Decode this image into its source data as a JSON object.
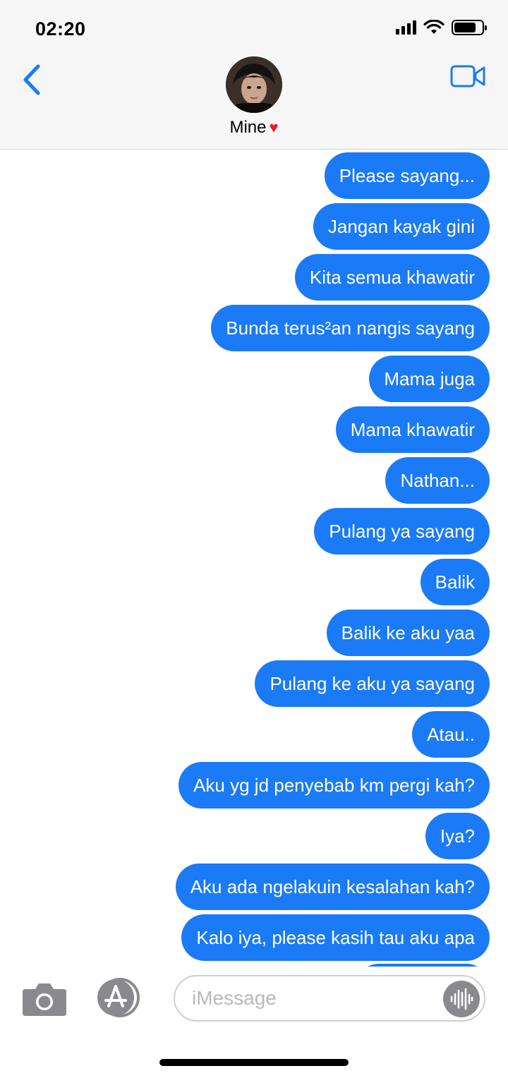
{
  "status_bar": {
    "time": "02:20"
  },
  "header": {
    "contact_name": "Mine",
    "contact_emoji": "♥",
    "back_icon": "chevron-left-icon",
    "video_icon": "video-camera-icon",
    "accent_color": "#1b7af6"
  },
  "messages": [
    {
      "text": "Please sayang..."
    },
    {
      "text": "Jangan kayak gini"
    },
    {
      "text": "Kita semua khawatir"
    },
    {
      "text": "Bunda terus²an nangis sayang"
    },
    {
      "text": "Mama juga"
    },
    {
      "text": "Mama khawatir"
    },
    {
      "text": "Nathan..."
    },
    {
      "text": "Pulang ya sayang"
    },
    {
      "text": "Balik"
    },
    {
      "text": "Balik ke aku yaa"
    },
    {
      "text": "Pulang ke aku ya sayang"
    },
    {
      "text": "Atau.."
    },
    {
      "text": "Aku yg jd penyebab km pergi kah?"
    },
    {
      "text": "Iya?"
    },
    {
      "text": "Aku ada ngelakuin kesalahan kah?"
    },
    {
      "text": "Kalo iya, please kasih tau aku apa"
    }
  ],
  "input": {
    "placeholder": "iMessage",
    "camera_icon": "camera-icon",
    "apps_icon": "app-store-icon",
    "audio_icon": "waveform-icon"
  }
}
